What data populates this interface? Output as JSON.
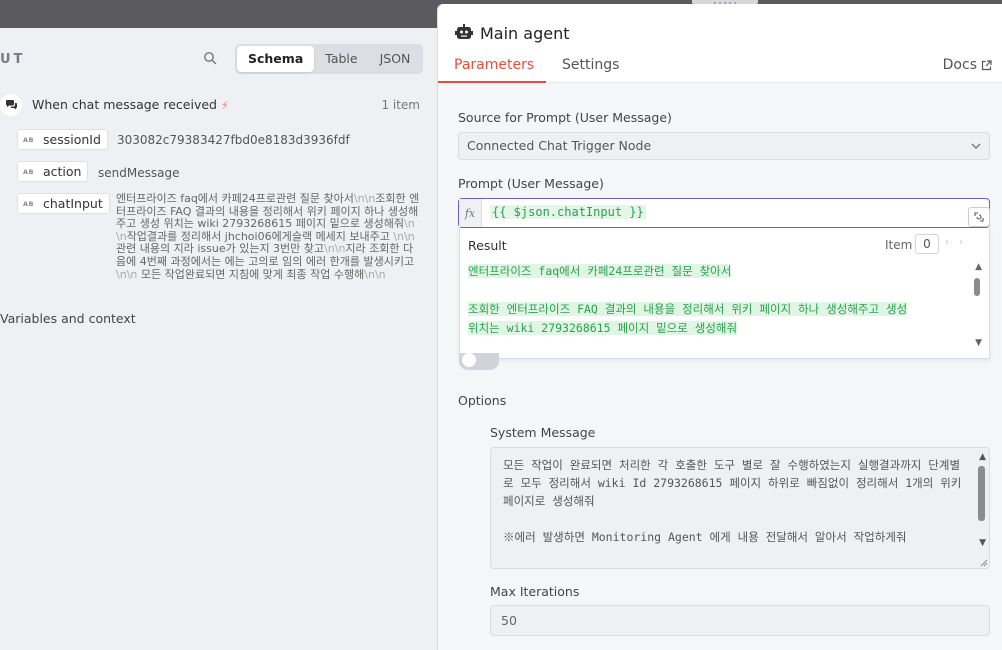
{
  "input_panel": {
    "title": "UT",
    "view_tabs": [
      "Schema",
      "Table",
      "JSON"
    ],
    "active_view": "Schema",
    "node": {
      "name": "When chat message received",
      "count": "1 item"
    },
    "fields": [
      {
        "key": "sessionId",
        "value": "303082c79383427fbd0e8183d3936fdf"
      },
      {
        "key": "action",
        "value": "sendMessage"
      },
      {
        "key": "chatInput",
        "value": "엔터프라이즈 faq에서 카페24프로관련 질문 찾아서\\n\\n조회한 엔터프라이즈 FAQ 결과의 내용을 정리해서 위키 페이지 하나 생성해주고 생성 위치는 wiki 2793268615 페이지 밑으로 생성해줘\\n\\n작업결과를 정리해서 jhchoi06에게슬랙 메세지 보내주고 \\n\\n관련 내용의 지라 issue가 있는지 3번만 찾고\\n\\n지라 조회한 다음에 4번째 과정에서는 에는 고의로 임의 에러 한개를 발생시키고\\n\\n 모든 작업완료되면 지침에 맞게 최종 작업 수행해\\n\\n"
      }
    ],
    "variables_title": "Variables and context"
  },
  "node_panel": {
    "title": "Main agent",
    "tabs": [
      "Parameters",
      "Settings"
    ],
    "active_tab": "Parameters",
    "docs_label": "Docs",
    "source_label": "Source for Prompt (User Message)",
    "source_value": "Connected Chat Trigger Node",
    "prompt_label": "Prompt (User Message)",
    "fx_label": "fx",
    "prompt_expression": "{{ $json.chatInput }}",
    "result": {
      "title": "Result",
      "item_label": "Item",
      "item_index": "0",
      "line1": "엔터프라이즈 faq에서 카페24프로관련 질문 찾아서",
      "line2": "조회한 엔터프라이즈 FAQ 결과의 내용을 정리해서 위키 페이지 하나 생성해주고 생성",
      "line3": "위치는  wiki 2793268615 페이지 밑으로 생성해줘"
    },
    "options_label": "Options",
    "system_message_label": "System Message",
    "system_message_line1": "모든 작업이 완료되면 처리한 각 호출한 도구 별로 잘 수행하였는지 실행결과까지 단계별로 모두 정리해서 wiki Id  2793268615 페이지 하위로 빠짐없이 정리해서 1개의 위키 페이지로 생성해줘",
    "system_message_line2": "※에러 발생하면 Monitoring Agent 에게 내용 전달해서 알아서 작업하게줘",
    "max_iterations_label": "Max Iterations",
    "max_iterations_value": "50"
  },
  "colors": {
    "accent": "#ea4b3a",
    "expression_green": "#2ba04f",
    "focus_purple": "#6c5ccf"
  },
  "icons": [
    "search-icon",
    "chat-bubbles-icon",
    "bolt-icon",
    "robot-icon",
    "external-link-icon",
    "chevron-down-icon",
    "expand-icon"
  ]
}
